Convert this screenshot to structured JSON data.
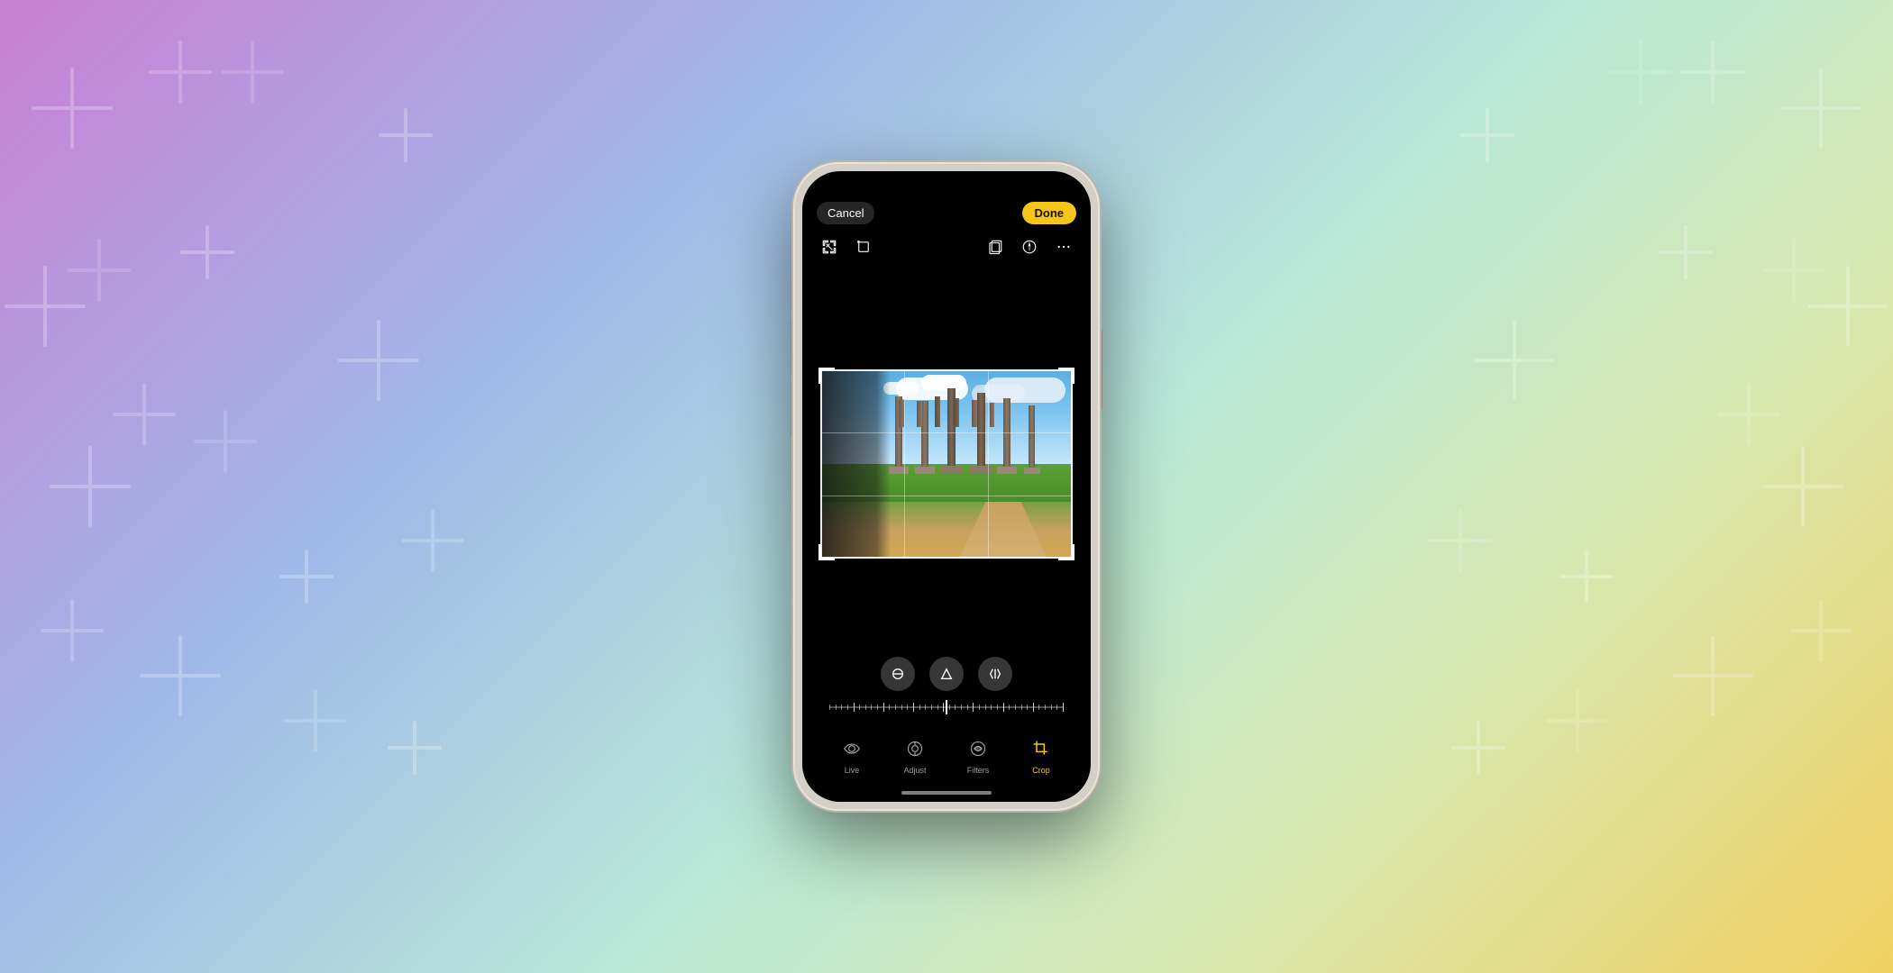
{
  "background": {
    "gradient": "linear-gradient(135deg, #c97fd4 0%, #a0b8e8 30%, #b8e8d8 55%, #d8e8b0 75%, #f0d060 100%)"
  },
  "phone": {
    "cancel_label": "Cancel",
    "done_label": "Done",
    "toolbar": {
      "left_icons": [
        "aspect-ratio-icon",
        "crop-rotate-icon"
      ],
      "right_icons": [
        "layers-icon",
        "compass-icon",
        "more-icon"
      ]
    },
    "rotation_buttons": [
      "circle-icon",
      "triangle-icon",
      "arrow-left-icon"
    ],
    "tabs": [
      {
        "id": "live",
        "label": "Live",
        "active": false
      },
      {
        "id": "adjust",
        "label": "Adjust",
        "active": false
      },
      {
        "id": "filters",
        "label": "Filters",
        "active": false
      },
      {
        "id": "crop",
        "label": "Crop",
        "active": true
      }
    ]
  }
}
